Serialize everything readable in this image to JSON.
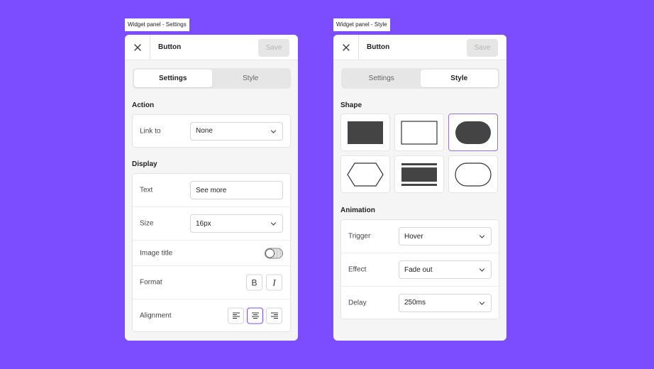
{
  "settings_panel": {
    "tag": "Widget panel - Settings",
    "title": "Button",
    "save_label": "Save",
    "tabs": [
      {
        "label": "Settings",
        "active": true
      },
      {
        "label": "Style",
        "active": false
      }
    ],
    "action": {
      "section_label": "Action",
      "link_to": {
        "label": "Link to",
        "value": "None"
      }
    },
    "display": {
      "section_label": "Display",
      "text": {
        "label": "Text",
        "value": "See more"
      },
      "size": {
        "label": "Size",
        "value": "16px"
      },
      "image_title": {
        "label": "Image title",
        "on": false
      },
      "format": {
        "label": "Format",
        "bold_glyph": "B",
        "italic_glyph": "I"
      },
      "alignment": {
        "label": "Alignment",
        "selected": "center"
      }
    }
  },
  "style_panel": {
    "tag": "Widget panel - Style",
    "title": "Button",
    "save_label": "Save",
    "tabs": [
      {
        "label": "Settings",
        "active": false
      },
      {
        "label": "Style",
        "active": true
      }
    ],
    "shape": {
      "section_label": "Shape",
      "options": [
        "filled-rectangle",
        "outline-rectangle",
        "filled-pill",
        "outline-hexagon",
        "striped-rectangle",
        "outline-pill"
      ],
      "selected": "filled-pill"
    },
    "animation": {
      "section_label": "Animation",
      "trigger": {
        "label": "Trigger",
        "value": "Hover"
      },
      "effect": {
        "label": "Effect",
        "value": "Fade out"
      },
      "delay": {
        "label": "Delay",
        "value": "250ms"
      }
    }
  },
  "colors": {
    "background": "#7c4dff",
    "accent": "#7c4dff",
    "shape_fill": "#444444"
  }
}
